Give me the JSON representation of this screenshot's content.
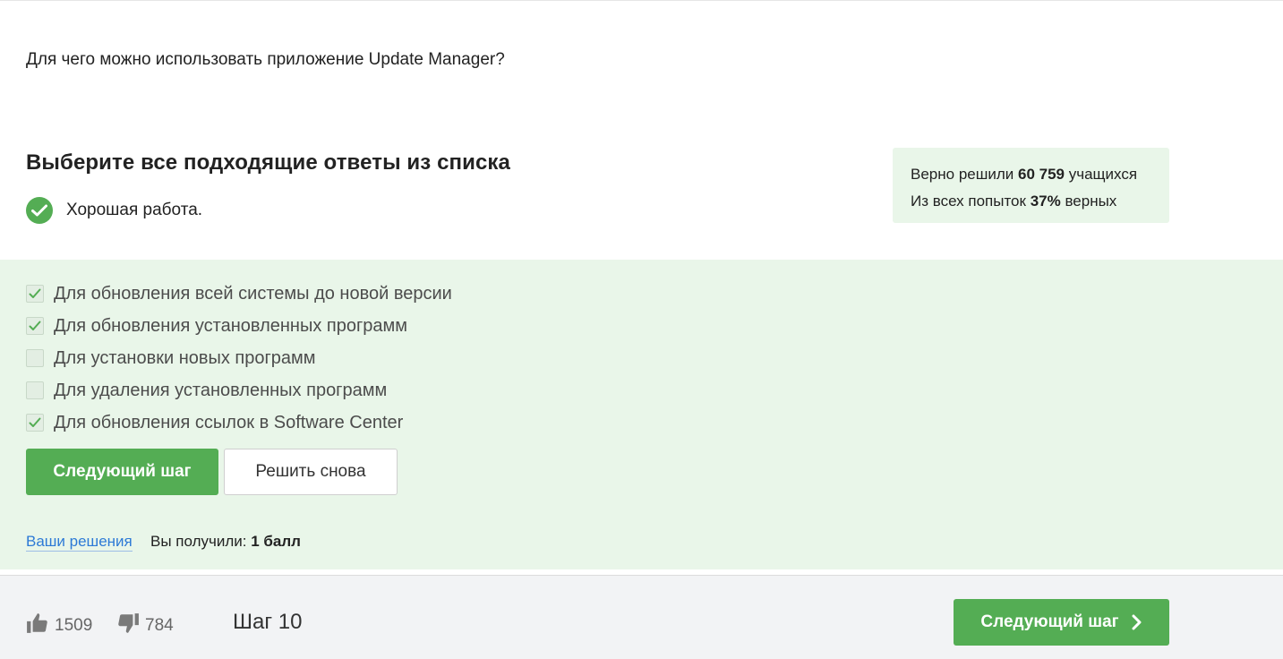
{
  "question": {
    "text": "Для чего можно использовать приложение Update Manager?"
  },
  "instruction": {
    "heading": "Выберите все подходящие ответы из списка"
  },
  "feedback": {
    "text": "Хорошая работа.",
    "icon": "check-circle-icon"
  },
  "stats": {
    "solved_prefix": "Верно решили",
    "solved_count": "60 759",
    "solved_suffix": "учащихся",
    "attempts_prefix": "Из всех попыток",
    "attempts_percent": "37%",
    "attempts_suffix": "верных"
  },
  "options": [
    {
      "label": "Для обновления всей системы до новой версии",
      "checked": true
    },
    {
      "label": "Для обновления установленных программ",
      "checked": true
    },
    {
      "label": "Для установки новых программ",
      "checked": false
    },
    {
      "label": "Для удаления установленных программ",
      "checked": false
    },
    {
      "label": "Для обновления ссылок в Software Center",
      "checked": true
    }
  ],
  "buttons": {
    "next_step": "Следующий шаг",
    "retry": "Решить снова"
  },
  "result": {
    "solutions_link": "Ваши решения",
    "score_prefix": "Вы получили:",
    "score_value": "1 балл"
  },
  "footer": {
    "likes": "1509",
    "dislikes": "784",
    "step_label": "Шаг 10",
    "next_step": "Следующий шаг"
  },
  "colors": {
    "accent": "#54ad54",
    "panel_bg": "#e9f6e9",
    "link": "#2d7ad6",
    "footer_bg": "#f2f3f5"
  }
}
